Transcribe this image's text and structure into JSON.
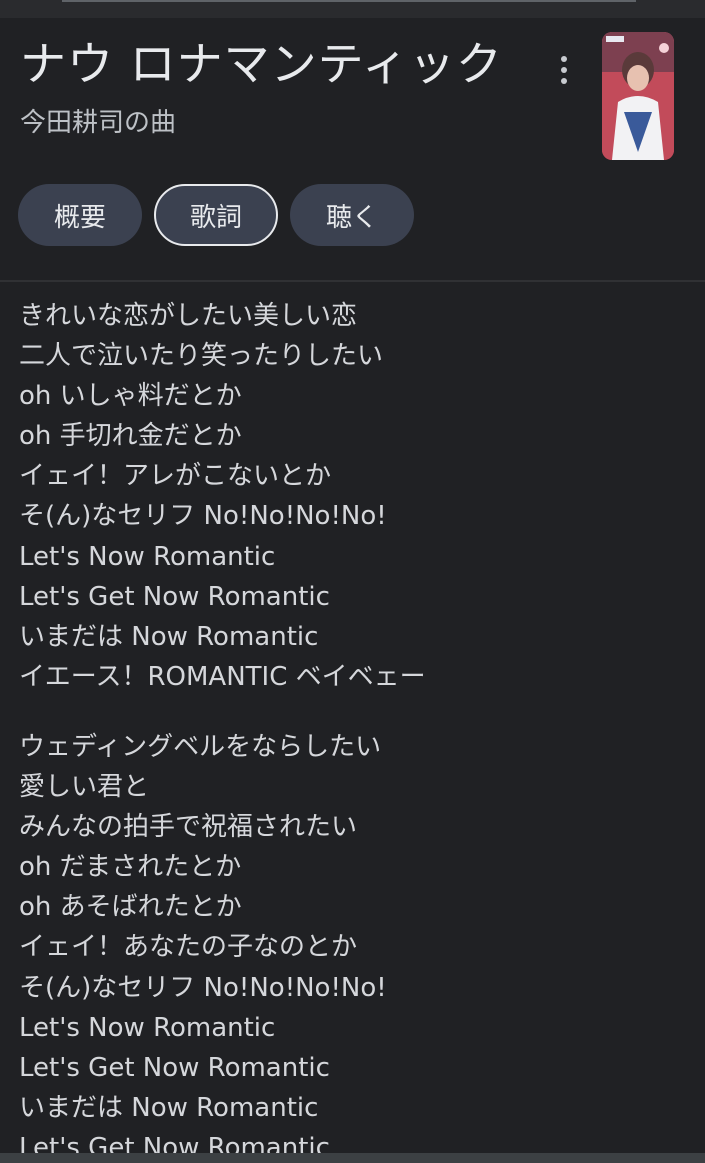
{
  "song": {
    "title": "ナウ ロナマンティック",
    "subtitle": "今田耕司の曲"
  },
  "icons": {
    "more": "more-vert-icon",
    "thumbnail": "album-art"
  },
  "tabs": [
    {
      "label": "概要",
      "selected": false
    },
    {
      "label": "歌詞",
      "selected": true
    },
    {
      "label": "聴く",
      "selected": false
    }
  ],
  "lyrics": {
    "stanza1": [
      "きれいな恋がしたい美しい恋",
      "二人で泣いたり笑ったりしたい",
      "oh いしゃ料だとか",
      "oh 手切れ金だとか",
      "イェイ！アレがこないとか",
      "そ(ん)なセリフ No!No!No!No!",
      "Let's Now Romantic",
      "Let's Get Now Romantic",
      "いまだは Now Romantic",
      "イエース！ROMANTIC ベイベェー"
    ],
    "stanza2": [
      "ウェディングベルをならしたい",
      "愛しい君と",
      "みんなの拍手で祝福されたい",
      "oh だまされたとか",
      "oh あそばれたとか",
      "イェイ！あなたの子なのとか",
      "そ(ん)なセリフ No!No!No!No!",
      "Let's Now Romantic",
      "Let's Get Now Romantic",
      "いまだは Now Romantic",
      "Let's Get Now Romantic"
    ]
  },
  "colors": {
    "background": "#202124",
    "chip": "#3b4150",
    "text": "#e8eaed"
  }
}
